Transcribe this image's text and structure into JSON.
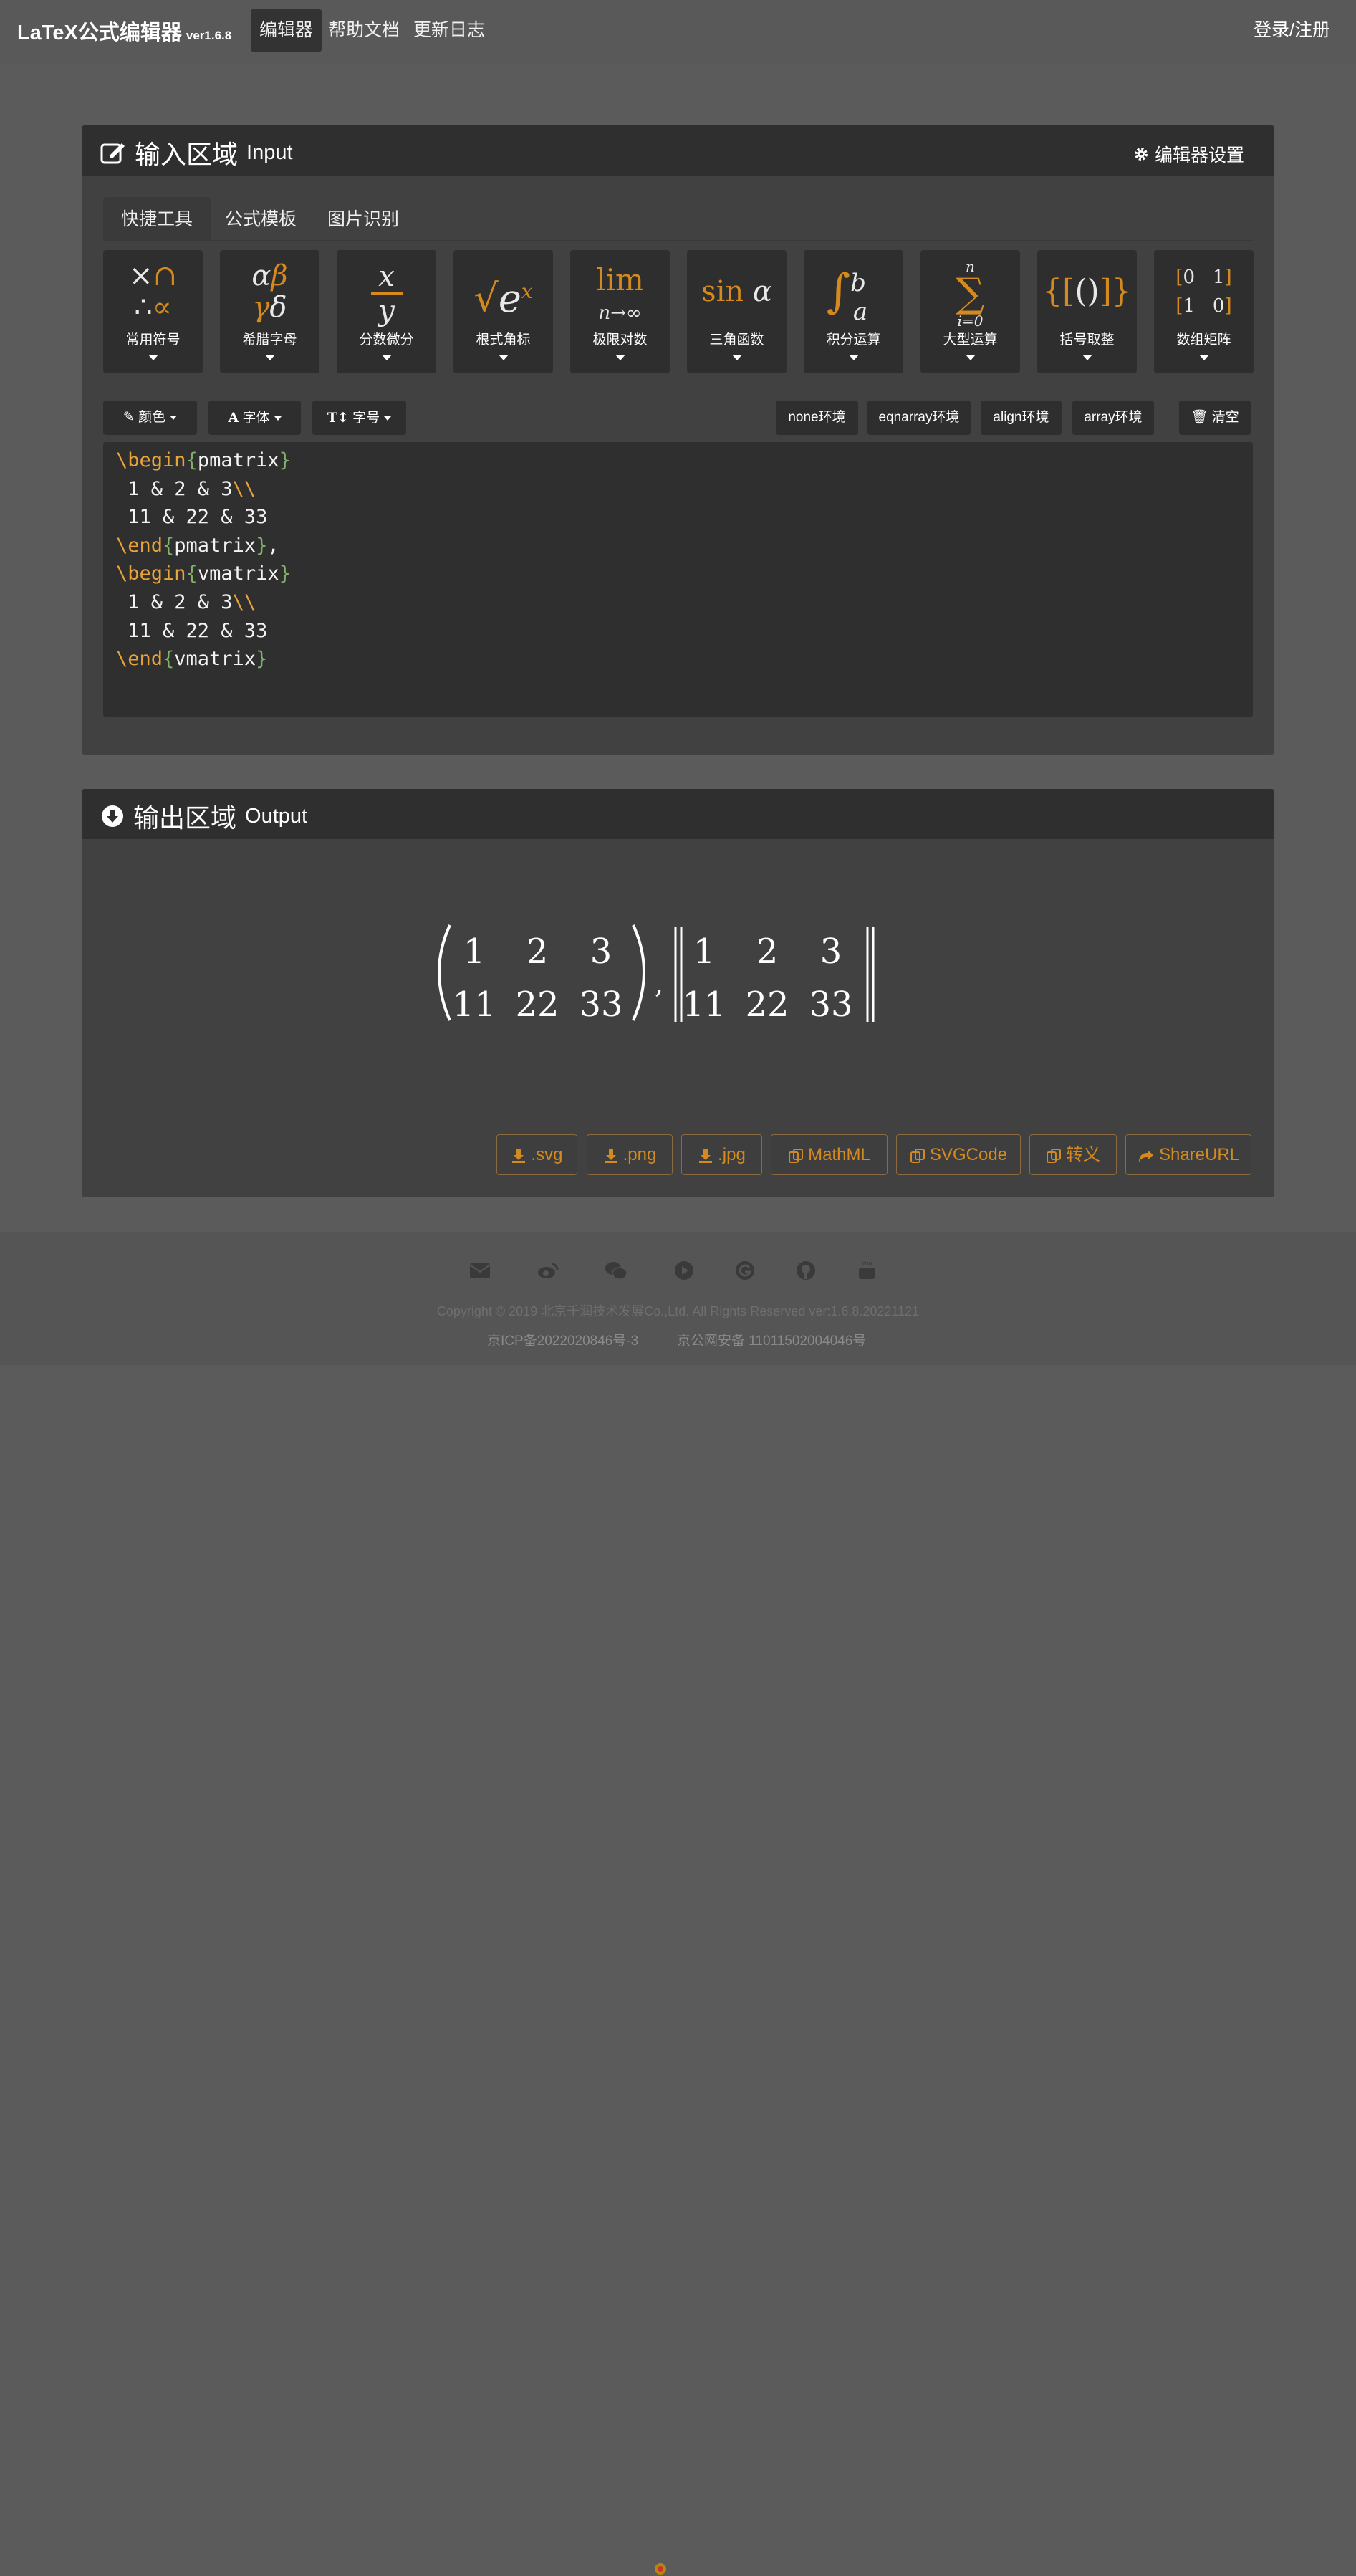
{
  "navbar": {
    "brand": "LaTeX公式编辑器",
    "version": "ver1.6.8",
    "items": [
      "编辑器",
      "帮助文档",
      "更新日志"
    ],
    "login": "登录/注册"
  },
  "input_panel": {
    "title": "输入区域",
    "subtitle": "Input",
    "settings": "编辑器设置",
    "tabs": [
      "快捷工具",
      "公式模板",
      "图片识别"
    ],
    "active_tab": "快捷工具",
    "tools": [
      {
        "label": "常用符号",
        "icon": "common-symbols"
      },
      {
        "label": "希腊字母",
        "icon": "greek-letters"
      },
      {
        "label": "分数微分",
        "icon": "fraction"
      },
      {
        "label": "根式角标",
        "icon": "radical"
      },
      {
        "label": "极限对数",
        "icon": "limit"
      },
      {
        "label": "三角函数",
        "icon": "trig"
      },
      {
        "label": "积分运算",
        "icon": "integral"
      },
      {
        "label": "大型运算",
        "icon": "sum"
      },
      {
        "label": "括号取整",
        "icon": "brackets"
      },
      {
        "label": "数组矩阵",
        "icon": "matrix"
      }
    ],
    "format_buttons": [
      "颜色",
      "字体",
      "字号"
    ],
    "env_buttons": [
      "none环境",
      "eqnarray环境",
      "align环境",
      "array环境"
    ],
    "clear": "清空",
    "code": [
      "\\begin{pmatrix}",
      " 1 & 2 & 3\\\\",
      " 11 & 22 & 33",
      "\\end{pmatrix},",
      "\\begin{vmatrix}",
      " 1 & 2 & 3\\\\",
      " 11 & 22 & 33",
      "\\end{vmatrix}"
    ]
  },
  "output_panel": {
    "title": "输出区域",
    "subtitle": "Output",
    "matrix1": [
      [
        "1",
        "2",
        "3"
      ],
      [
        "11",
        "22",
        "33"
      ]
    ],
    "matrix2": [
      [
        "1",
        "2",
        "3"
      ],
      [
        "11",
        "22",
        "33"
      ]
    ],
    "buttons": [
      ".svg",
      ".png",
      ".jpg",
      "MathML",
      "SVGCode",
      "转义",
      "ShareURL"
    ]
  },
  "footer": {
    "icons": [
      "email-icon",
      "weibo-icon",
      "wechat-icon",
      "video-icon",
      "g-icon",
      "github-icon",
      "youtube-icon"
    ],
    "copyright": "Copyright © 2019 北京千润技术发展Co.,Ltd. All Rights Reserved  ver:1.6.8.20221121",
    "icp": "京ICP备2022020846号-3",
    "police": "京公网安备 11011502004046号"
  },
  "colors": {
    "accent": "#d48a1e",
    "background": "#5b5b5b",
    "panel": "#414141",
    "panel_header": "#2f2f2f"
  }
}
